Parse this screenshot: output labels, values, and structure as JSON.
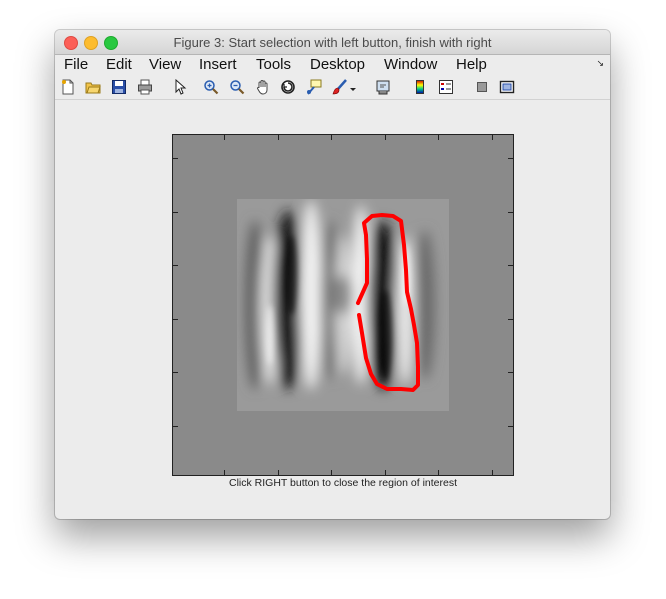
{
  "window": {
    "title": "Figure 3: Start selection with left button, finish with right"
  },
  "menu": {
    "items": [
      "File",
      "Edit",
      "View",
      "Insert",
      "Tools",
      "Desktop",
      "Window",
      "Help"
    ]
  },
  "toolbar": {
    "icons": [
      "new-figure-icon",
      "open-file-icon",
      "save-icon",
      "print-icon",
      "arrow-pointer-icon",
      "zoom-in-icon",
      "zoom-out-icon",
      "pan-hand-icon",
      "rotate-3d-icon",
      "data-cursor-icon",
      "brush-icon",
      "link-plot-icon",
      "colorbar-icon",
      "legend-icon",
      "hide-plot-tools-icon",
      "show-plot-tools-icon"
    ]
  },
  "figure": {
    "status_text": "Click RIGHT button to close the region of interest",
    "roi_color": "#ff0000",
    "background_gray": "#8a8a8a"
  }
}
